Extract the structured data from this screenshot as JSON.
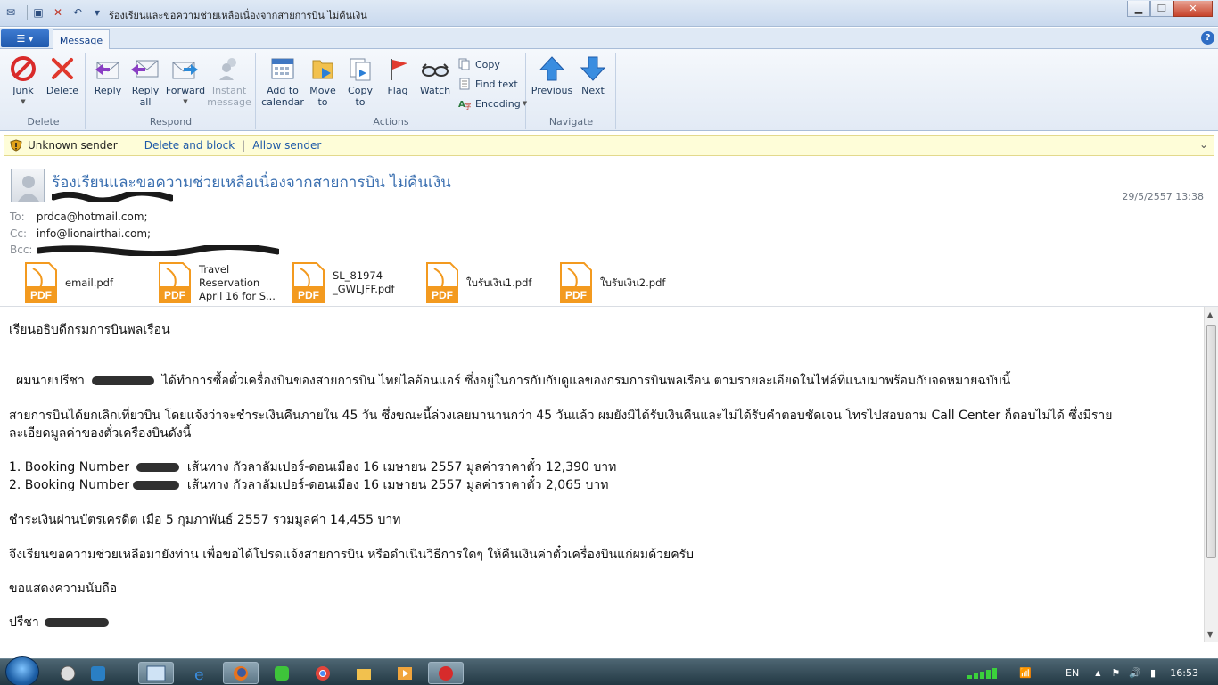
{
  "window": {
    "title": "ร้องเรียนและขอความช่วยเหลือเนื่องจากสายการบิน ไม่คืนเงิน",
    "min_label": "▁",
    "max_label": "❐",
    "close_label": "✕"
  },
  "ribbon": {
    "tab_message": "Message",
    "help": "?",
    "groups": {
      "delete": "Delete",
      "respond": "Respond",
      "actions": "Actions",
      "navigate": "Navigate"
    },
    "buttons": {
      "junk": "Junk",
      "delete": "Delete",
      "reply": "Reply",
      "reply_all_1": "Reply",
      "reply_all_2": "all",
      "forward": "Forward",
      "instant_1": "Instant",
      "instant_2": "message",
      "calendar_1": "Add to",
      "calendar_2": "calendar",
      "move_1": "Move",
      "move_2": "to",
      "copyto_1": "Copy",
      "copyto_2": "to",
      "flag": "Flag",
      "watch": "Watch",
      "copy": "Copy",
      "find_text": "Find text",
      "encoding": "Encoding",
      "previous": "Previous",
      "next": "Next"
    }
  },
  "infobar": {
    "message": "Unknown sender",
    "delete_block": "Delete and block",
    "allow": "Allow sender"
  },
  "header": {
    "subject": "ร้องเรียนและขอความช่วยเหลือเนื่องจากสายการบิน ไม่คืนเงิน",
    "datetime": "29/5/2557 13:38",
    "to_label": "To:",
    "to_value": "prdca@hotmail.com;",
    "cc_label": "Cc:",
    "cc_value": "info@lionairthai.com;",
    "bcc_label": "Bcc:"
  },
  "attachments": [
    {
      "name_1": "email.pdf",
      "name_2": "",
      "name_3": ""
    },
    {
      "name_1": "Travel",
      "name_2": "Reservation",
      "name_3": "April 16 for S..."
    },
    {
      "name_1": "SL_81974",
      "name_2": "_GWLJFF.pdf",
      "name_3": ""
    },
    {
      "name_1": "ใบรับเงิน1.pdf",
      "name_2": "",
      "name_3": ""
    },
    {
      "name_1": "ใบรับเงิน2.pdf",
      "name_2": "",
      "name_3": ""
    }
  ],
  "body": {
    "greeting": "เรียนอธิบดีกรมการบินพลเรือน",
    "p1_a": "ผมนายปรีชา",
    "p1_b": "ได้ทำการซื้อตั๋วเครื่องบินของสายการบิน ไทยไลอ้อนแอร์ ซึ่งอยู่ในการกับกับดูแลของกรมการบินพลเรือน ตามรายละเอียดในไฟล์ที่แนบมาพร้อมกับจดหมายฉบับนี้",
    "p2_line1": "สายการบินได้ยกเลิกเที่ยวบิน โดยแจ้งว่าจะชำระเงินคืนภายใน 45 วัน ซึ่งขณะนี้ล่วงเลยมานานกว่า 45 วันแล้ว ผมยังมิได้รับเงินคืนและไม่ได้รับคำตอบชัดเจน โทรไปสอบถาม Call Center ก็ตอบไม่ได้ ซึ่งมีราย",
    "p2_line2": "ละเอียดมูลค่าของตั๋วเครื่องบินดังนี้",
    "item1_a": "1. Booking Number",
    "item1_b": "เส้นทาง กัวลาลัมเปอร์-ดอนเมือง 16 เมษายน 2557 มูลค่าราคาตั๋ว 12,390 บาท",
    "item2_a": "2. Booking Number",
    "item2_b": "เส้นทาง กัวลาลัมเปอร์-ดอนเมือง 16 เมษายน 2557 มูลค่าราคาตั๋ว 2,065 บาท",
    "payment": "ชำระเงินผ่านบัตรเครดิต เมื่อ 5 กุมภาพันธ์ 2557 รวมมูลค่า 14,455 บาท",
    "request": "จึงเรียนขอความช่วยเหลือมายังท่าน เพื่อขอได้โปรดแจ้งสายการบิน หรือดำเนินวิธีการใดๆ ให้คืนเงินค่าตั๋วเครื่องบินแก่ผมด้วยครับ",
    "closing": "ขอแสดงความนับถือ",
    "signature": "ปรีชา"
  },
  "taskbar": {
    "lang": "EN",
    "clock": "16:53"
  },
  "colors": {
    "ribbon_bg": "#e2eaf5",
    "link": "#1f5aa8",
    "subject": "#3a6fb0",
    "infobar_bg": "#fefdd8",
    "pdf_orange": "#f39a1f"
  }
}
